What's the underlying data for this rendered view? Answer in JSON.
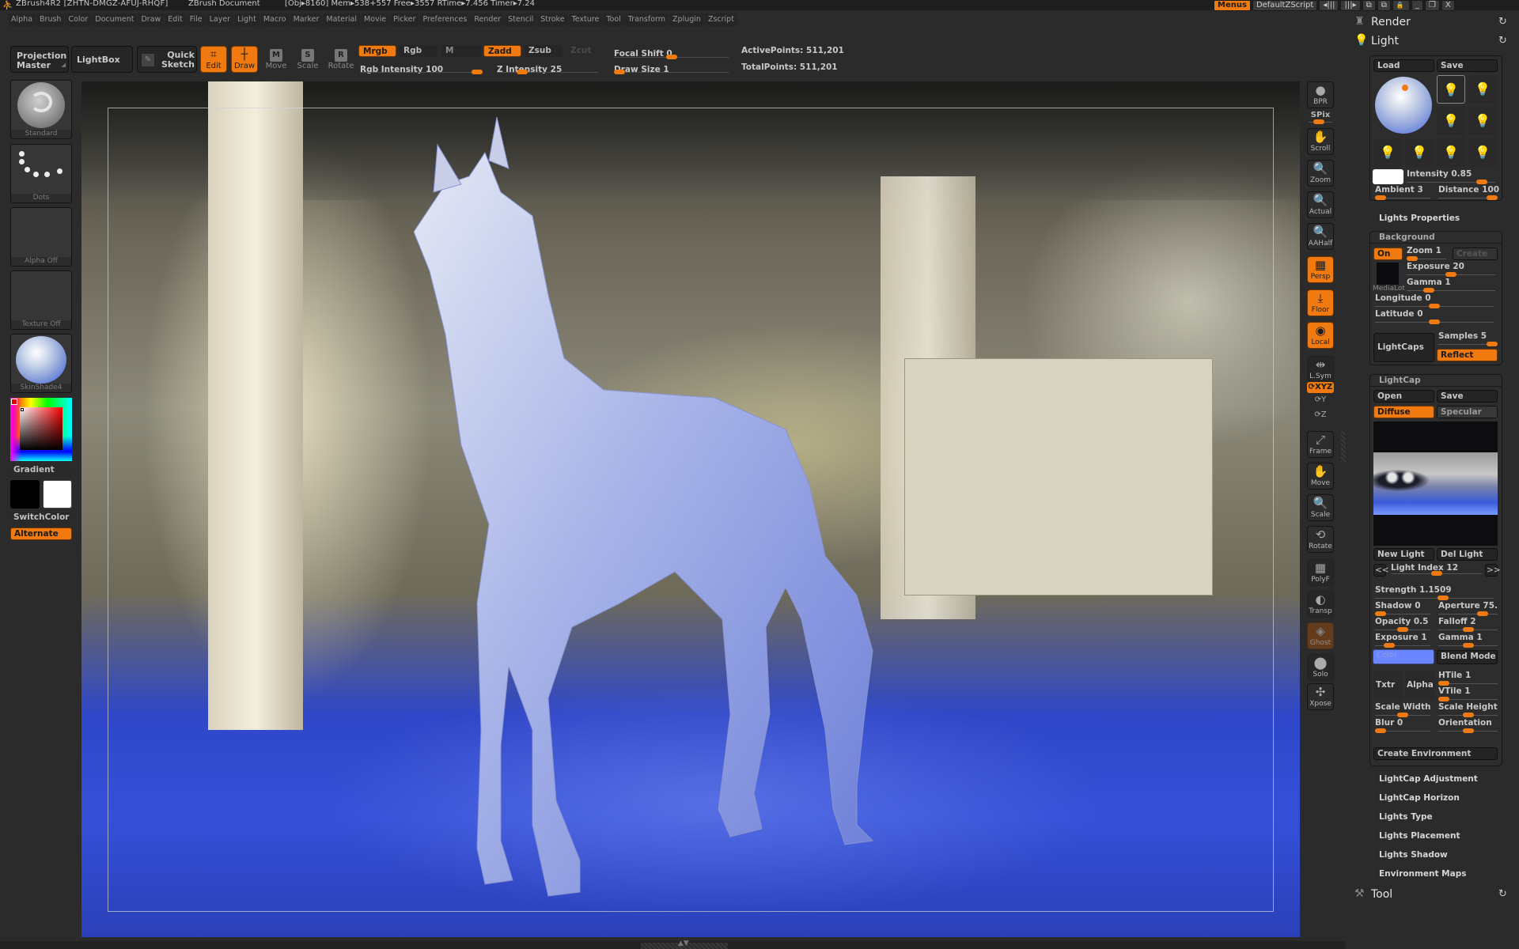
{
  "titlebar": {
    "app": "ZBrush4R2",
    "serial": "[ZHTN-DMGZ-AFUJ-RHQF]",
    "document": "ZBrush Document",
    "stats": "[Obj▸8160] Mem▸538+557 Free▸3557 RTime▸7.456 Timer▸7.24",
    "menus_btn": "Menus",
    "script_btn": "DefaultZScript",
    "win_buttons": [
      "◂|||",
      "|||▸",
      "⧉",
      "⧉",
      "🔒",
      "_",
      "❐",
      "X"
    ]
  },
  "menubar": {
    "items": [
      "Alpha",
      "Brush",
      "Color",
      "Document",
      "Draw",
      "Edit",
      "File",
      "Layer",
      "Light",
      "Macro",
      "Marker",
      "Material",
      "Movie",
      "Picker",
      "Preferences",
      "Render",
      "Stencil",
      "Stroke",
      "Texture",
      "Tool",
      "Transform",
      "Zplugin",
      "Zscript"
    ]
  },
  "toolbar": {
    "projection_master": "Projection Master",
    "lightbox": "LightBox",
    "quick_sketch": "Quick Sketch",
    "edit": "Edit",
    "draw": "Draw",
    "move": "Move",
    "scale": "Scale",
    "rotate": "Rotate",
    "move_key": "M",
    "scale_key": "S",
    "rotate_key": "R",
    "mrgb": "Mrgb",
    "rgb": "Rgb",
    "m": "M",
    "zadd": "Zadd",
    "zsub": "Zsub",
    "zcut": "Zcut",
    "rgb_intensity": {
      "label": "Rgb Intensity",
      "value": 100,
      "max": 100
    },
    "z_intensity": {
      "label": "Z Intensity",
      "value": 25,
      "max": 100
    },
    "focal_shift": {
      "label": "Focal Shift",
      "value": 0,
      "min": -100,
      "max": 100
    },
    "draw_size": {
      "label": "Draw Size",
      "value": 1,
      "max": 1000
    },
    "active_points": "ActivePoints: 511,201",
    "total_points": "TotalPoints: 511,201"
  },
  "left_shelf": {
    "brush": "Standard",
    "stroke": "Dots",
    "alpha": "Alpha Off",
    "texture": "Texture Off",
    "material": "SkinShade4",
    "gradient": "Gradient",
    "switch_color": "SwitchColor",
    "alternate": "Alternate",
    "main_color": "#000000",
    "secondary_color": "#ffffff"
  },
  "right_strip": {
    "buttons": [
      {
        "id": "bpr",
        "label": "BPR",
        "glyph": "●",
        "state": "normal"
      },
      {
        "id": "scroll",
        "label": "Scroll",
        "glyph": "✋",
        "state": "normal"
      },
      {
        "id": "zoom",
        "label": "Zoom",
        "glyph": "🔍",
        "state": "normal"
      },
      {
        "id": "actual",
        "label": "Actual",
        "glyph": "🔍",
        "state": "normal"
      },
      {
        "id": "aahalf",
        "label": "AAHalf",
        "glyph": "🔍",
        "state": "normal"
      },
      {
        "id": "persp",
        "label": "Persp",
        "glyph": "▦",
        "state": "active"
      },
      {
        "id": "floor",
        "label": "Floor",
        "glyph": "⤓",
        "state": "active"
      },
      {
        "id": "local",
        "label": "Local",
        "glyph": "◉",
        "state": "active"
      },
      {
        "id": "lsym",
        "label": "L.Sym",
        "glyph": "⇹",
        "state": "plain"
      },
      {
        "id": "frame",
        "label": "Frame",
        "glyph": "⤢",
        "state": "normal"
      },
      {
        "id": "move",
        "label": "Move",
        "glyph": "✋",
        "state": "normal"
      },
      {
        "id": "scale",
        "label": "Scale",
        "glyph": "🔍",
        "state": "normal"
      },
      {
        "id": "rotate",
        "label": "Rotate",
        "glyph": "⟲",
        "state": "normal"
      },
      {
        "id": "polyf",
        "label": "PolyF",
        "glyph": "▦",
        "state": "plain"
      },
      {
        "id": "transp",
        "label": "Transp",
        "glyph": "◐",
        "state": "plain"
      },
      {
        "id": "ghost",
        "label": "Ghost",
        "glyph": "◈",
        "state": "disabled"
      },
      {
        "id": "solo",
        "label": "Solo",
        "glyph": "⬤",
        "state": "plain"
      },
      {
        "id": "xpose",
        "label": "Xpose",
        "glyph": "✣",
        "state": "normal"
      }
    ],
    "spix": {
      "label": "SPix",
      "value": 3,
      "max": 7
    },
    "xyz": "XYZ",
    "y_rot": "Y",
    "z_rot": "Z"
  },
  "palette": {
    "render": "Render",
    "light": "Light",
    "tool": "Tool",
    "light_panel": {
      "load": "Load",
      "save": "Save",
      "intensity": {
        "label": "Intensity",
        "value": 0.85,
        "max": 1
      },
      "ambient": {
        "label": "Ambient",
        "value": 3,
        "max": 100
      },
      "distance": {
        "label": "Distance",
        "value": 100,
        "max": 100
      },
      "light_color": "#ffffff"
    },
    "lights_properties": "Lights Properties",
    "background": {
      "title": "Background",
      "on": "On",
      "create": "Create",
      "thumb_label": "MediaLot",
      "zoom": {
        "label": "Zoom",
        "value": 1,
        "max": 10
      },
      "exposure": {
        "label": "Exposure",
        "value": 20,
        "max": 40
      },
      "gamma": {
        "label": "Gamma",
        "value": 1,
        "max": 4
      },
      "longitude": {
        "label": "Longitude",
        "value": 0,
        "min": -180,
        "max": 180
      },
      "latitude": {
        "label": "Latitude",
        "value": 0,
        "min": -90,
        "max": 90
      },
      "lightcaps": "LightCaps",
      "samples": {
        "label": "Samples",
        "value": 5,
        "max": 5
      },
      "reflect": "Reflect"
    },
    "lightcap": {
      "title": "LightCap",
      "open": "Open",
      "save": "Save",
      "diffuse": "Diffuse",
      "specular": "Specular",
      "new_light": "New Light",
      "del_light": "Del Light",
      "prev": "<<",
      "next": ">>",
      "light_index": {
        "label": "Light Index",
        "value": 12,
        "max": 24
      },
      "strength": {
        "label": "Strength",
        "value": 1.1509,
        "max": 2
      },
      "shadow": {
        "label": "Shadow",
        "value": 0,
        "max": 1
      },
      "aperture": {
        "label": "Aperture",
        "value": "75.",
        "frac": 0.75
      },
      "opacity": {
        "label": "Opacity",
        "value": 0.5,
        "max": 1
      },
      "falloff": {
        "label": "Falloff",
        "value": 2,
        "max": 4
      },
      "exposure": {
        "label": "Exposure",
        "value": 1,
        "max": 4
      },
      "gamma": {
        "label": "Gamma",
        "value": 1,
        "max": 2
      },
      "color_label": "Color",
      "color_value": "#6b86ff",
      "blend_mode": "Blend Mode",
      "txtr": "Txtr",
      "alpha": "Alpha",
      "htile": {
        "label": "HTile",
        "value": 1,
        "max": 100
      },
      "vtile": {
        "label": "VTile",
        "value": 1,
        "max": 100
      },
      "scale_width": {
        "label": "Scale Width",
        "frac": 0.5
      },
      "scale_height": {
        "label": "Scale Height",
        "frac": 0.5
      },
      "blur": {
        "label": "Blur",
        "value": 0,
        "max": 100
      },
      "orientation": {
        "label": "Orientation",
        "frac": 0.5
      },
      "create_environment": "Create Environment"
    },
    "subpalettes": [
      "LightCap Adjustment",
      "LightCap Horizon",
      "Lights Type",
      "Lights Placement",
      "Lights Shadow",
      "Environment Maps"
    ]
  },
  "colors": {
    "accent": "#f07a10",
    "bg": "#2b2b2b",
    "panel": "#2d2d2d"
  }
}
